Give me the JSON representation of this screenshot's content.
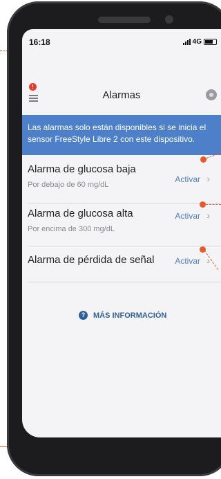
{
  "status_bar": {
    "time": "16:18",
    "network": "4G"
  },
  "nav": {
    "title": "Alarmas",
    "menu_badge": "!"
  },
  "banner": {
    "text": "Las alarmas solo están disponibles si se inicia el sensor FreeStyle Libre 2 con este dispositivo."
  },
  "alarms": [
    {
      "title": "Alarma de glucosa baja",
      "subtitle": "Por debajo de 60 mg/dL",
      "action": "Activar"
    },
    {
      "title": "Alarma de glucosa alta",
      "subtitle": "Por encima de 300 mg/dL",
      "action": "Activar"
    },
    {
      "title": "Alarma de pérdida de señal",
      "subtitle": "",
      "action": "Activar"
    }
  ],
  "more_info": {
    "label": "MÁS INFORMACIÓN",
    "icon": "?"
  },
  "colors": {
    "accent": "#4e80c9",
    "annotation": "#e8582a",
    "link": "#2f5f9a"
  }
}
